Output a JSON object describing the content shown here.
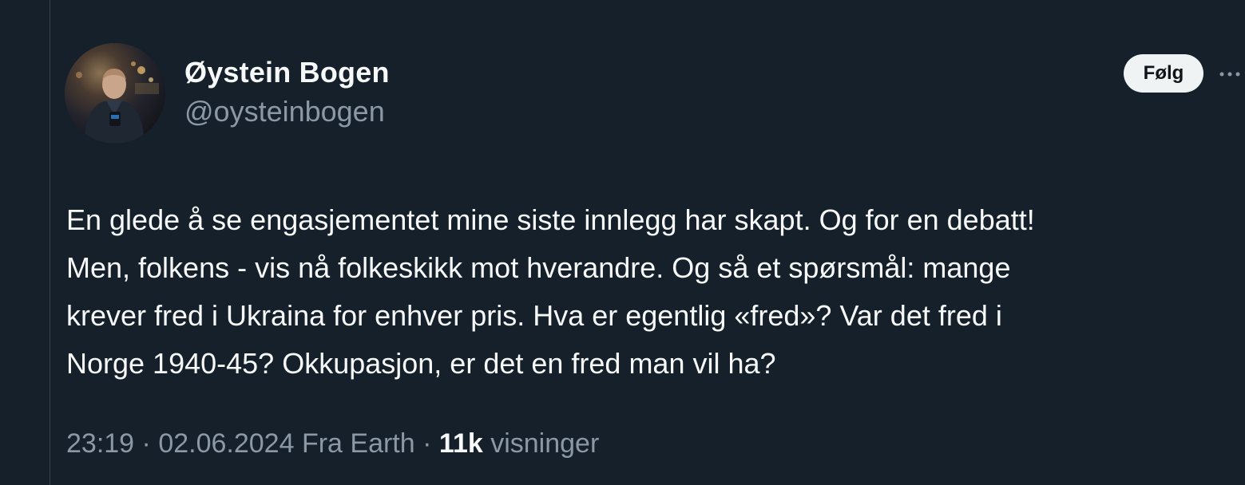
{
  "author": {
    "display_name": "Øystein Bogen",
    "handle": "@oysteinbogen"
  },
  "follow_button": {
    "label": "Følg"
  },
  "more_button": {
    "icon": "more-horizontal-icon"
  },
  "tweet": {
    "lines": [
      "En glede å se engasjementet mine siste innlegg har skapt. Og for en debatt!",
      "Men, folkens - vis nå folkeskikk mot hverandre. Og så et spørsmål: mange",
      "krever fred i Ukraina for enhver pris. Hva er egentlig «fred»? Var det fred i",
      "Norge 1940-45? Okkupasjon, er det en fred man vil ha?"
    ]
  },
  "meta": {
    "time": "23:19",
    "separator": "·",
    "date": "02.06.2024",
    "source": "Fra Earth",
    "views_count": "11k",
    "views_label": "visninger"
  },
  "colors": {
    "background": "#15202b",
    "text_primary": "#f7f9f9",
    "text_secondary": "#8b98a5",
    "follow_button_bg": "#eff3f4"
  }
}
